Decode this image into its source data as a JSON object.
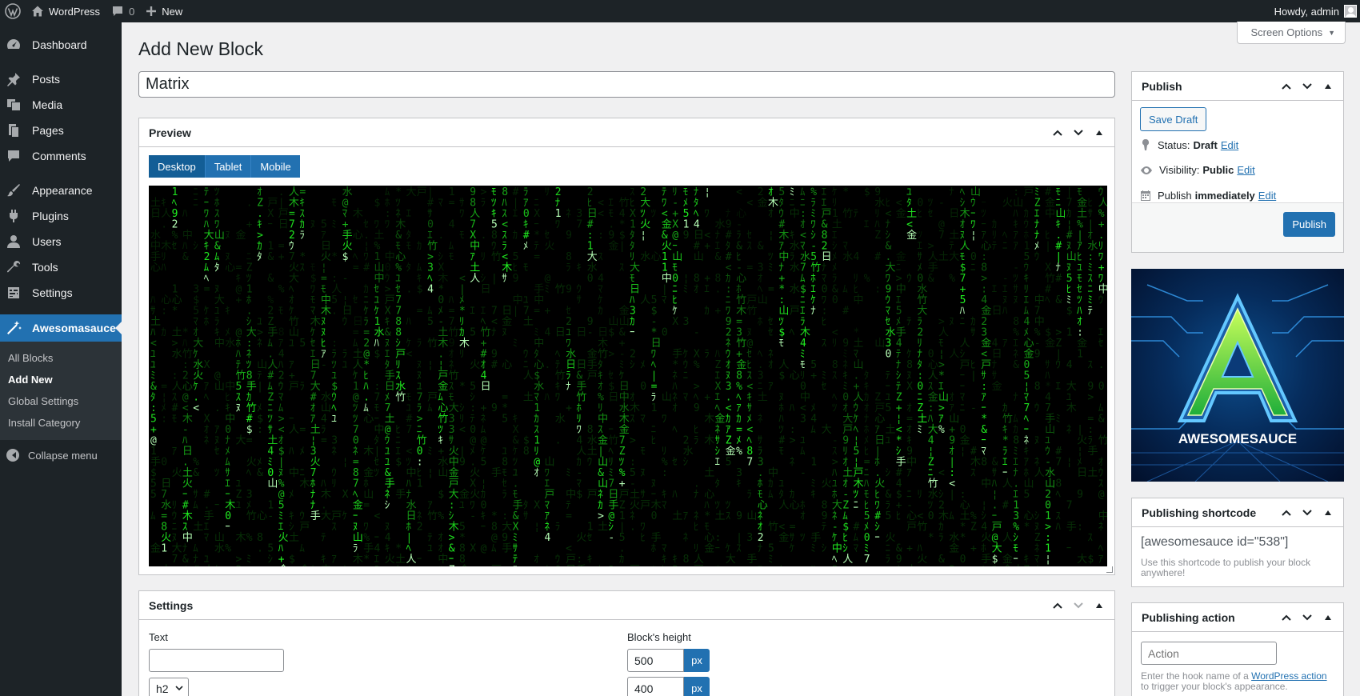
{
  "adminbar": {
    "site_name": "WordPress",
    "comments_count": "0",
    "new_label": "New",
    "howdy": "Howdy, admin"
  },
  "sidebar": {
    "items": [
      {
        "label": "Dashboard",
        "icon": "dashboard-icon"
      },
      {
        "label": "Posts",
        "icon": "pushpin-icon"
      },
      {
        "label": "Media",
        "icon": "media-icon"
      },
      {
        "label": "Pages",
        "icon": "pages-icon"
      },
      {
        "label": "Comments",
        "icon": "comment-icon"
      },
      {
        "label": "Appearance",
        "icon": "paintbrush-icon"
      },
      {
        "label": "Plugins",
        "icon": "plug-icon"
      },
      {
        "label": "Users",
        "icon": "user-icon"
      },
      {
        "label": "Tools",
        "icon": "wrench-icon"
      },
      {
        "label": "Settings",
        "icon": "settings-icon"
      },
      {
        "label": "Awesomasauce",
        "icon": "magic-wand-icon"
      }
    ],
    "submenu": [
      "All Blocks",
      "Add New",
      "Global Settings",
      "Install Category"
    ],
    "collapse_label": "Collapse menu"
  },
  "screen_options": "Screen Options",
  "page_title": "Add New Block",
  "title_value": "Matrix",
  "preview": {
    "title": "Preview",
    "tabs": [
      "Desktop",
      "Tablet",
      "Mobile"
    ],
    "active_tab": "Desktop"
  },
  "settings": {
    "title": "Settings",
    "text_label": "Text",
    "text_value": "",
    "heading_select": "h2",
    "height_label": "Block's height",
    "height_value": "500",
    "height_unit": "px",
    "second_value": "400",
    "second_unit": "px"
  },
  "publish": {
    "title": "Publish",
    "save_draft": "Save Draft",
    "status_label": "Status:",
    "status_value": "Draft",
    "visibility_label": "Visibility:",
    "visibility_value": "Public",
    "publish_label": "Publish",
    "publish_value": "immediately",
    "edit": "Edit",
    "publish_button": "Publish"
  },
  "logo": {
    "letter": "A",
    "wordmark": "AWESOMESAUCE"
  },
  "shortcode": {
    "title": "Publishing shortcode",
    "value": "[awesomesauce id=\"538\"]",
    "help": "Use this shortcode to publish your block anywhere!"
  },
  "action": {
    "title": "Publishing action",
    "placeholder": "Action",
    "help_prefix": "Enter the hook name of a ",
    "help_link": "WordPress action",
    "help_suffix": " to trigger your block's appearance."
  },
  "colors": {
    "admin_dark": "#1d2327",
    "accent": "#2271b1",
    "matrix_green": "#22ff22"
  }
}
